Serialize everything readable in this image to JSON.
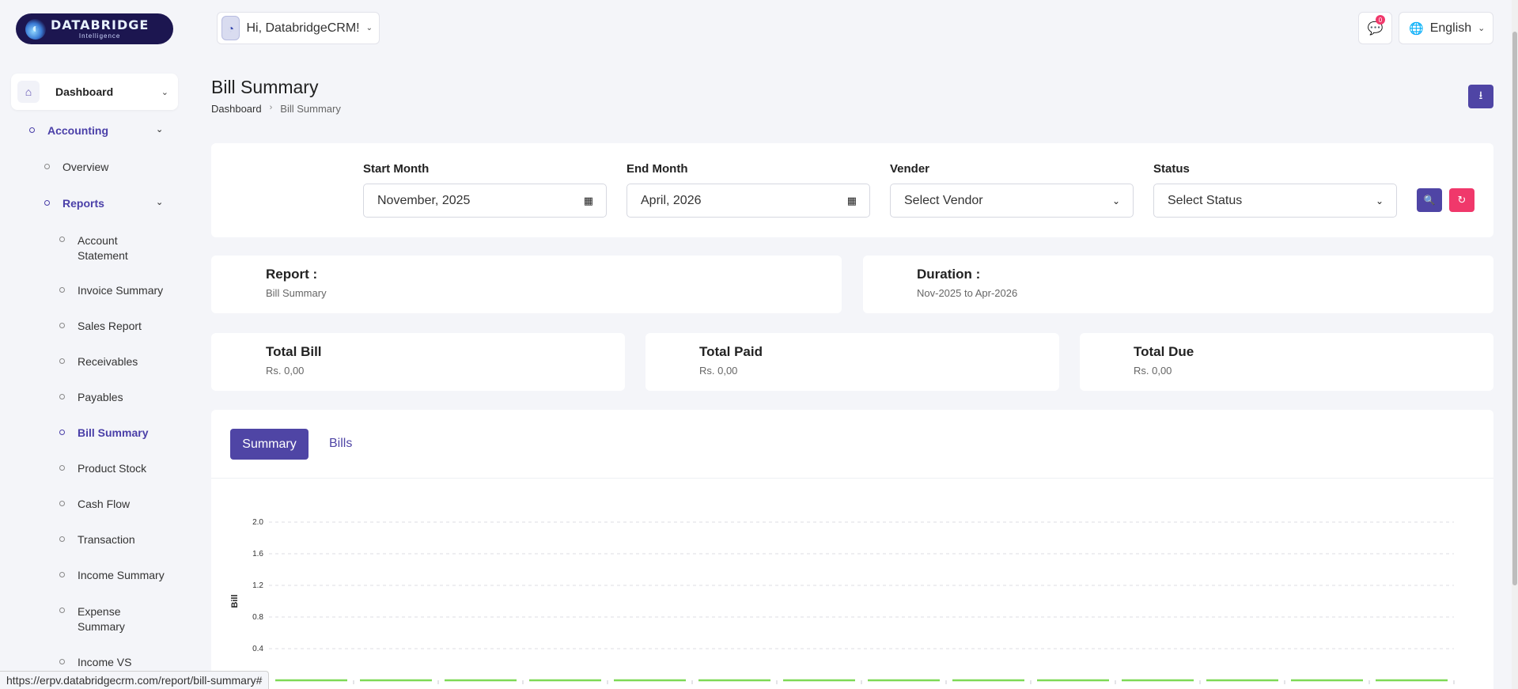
{
  "brand": {
    "name": "DATABRIDGE",
    "tagline": "Intelligence"
  },
  "sidebar": {
    "main": {
      "label": "Dashboard"
    },
    "accounting": {
      "label": "Accounting"
    },
    "overview": {
      "label": "Overview"
    },
    "reports": {
      "label": "Reports"
    },
    "report_items": [
      {
        "label": "Account Statement"
      },
      {
        "label": "Invoice Summary"
      },
      {
        "label": "Sales Report"
      },
      {
        "label": "Receivables"
      },
      {
        "label": "Payables"
      },
      {
        "label": "Bill Summary"
      },
      {
        "label": "Product Stock"
      },
      {
        "label": "Cash Flow"
      },
      {
        "label": "Transaction"
      },
      {
        "label": "Income Summary"
      },
      {
        "label": "Expense Summary"
      },
      {
        "label": "Income VS"
      }
    ],
    "active_item": "Bill Summary"
  },
  "topbar": {
    "greeting": "Hi, DatabridgeCRM!",
    "notification_count": "0",
    "language": "English"
  },
  "page": {
    "title": "Bill Summary",
    "breadcrumb": [
      "Dashboard",
      "Bill Summary"
    ]
  },
  "filters": {
    "start_month": {
      "label": "Start Month",
      "value": "November, 2025"
    },
    "end_month": {
      "label": "End Month",
      "value": "April, 2026"
    },
    "vendor": {
      "label": "Vender",
      "value": "Select Vendor"
    },
    "status": {
      "label": "Status",
      "value": "Select Status"
    }
  },
  "report_info": {
    "report": {
      "title": "Report :",
      "value": "Bill Summary"
    },
    "duration": {
      "title": "Duration :",
      "value": "Nov-2025 to Apr-2026"
    }
  },
  "totals": {
    "bill": {
      "title": "Total Bill",
      "value": "Rs. 0,00"
    },
    "paid": {
      "title": "Total Paid",
      "value": "Rs. 0,00"
    },
    "due": {
      "title": "Total Due",
      "value": "Rs. 0,00"
    }
  },
  "tabs": {
    "summary": "Summary",
    "bills": "Bills"
  },
  "chart_data": {
    "type": "line",
    "ylabel": "Bill",
    "yticks": [
      "0.4",
      "0.8",
      "1.2",
      "1.6",
      "2.0"
    ],
    "ylim": [
      0,
      2.0
    ],
    "series": [
      {
        "values": [
          0,
          0,
          0,
          0,
          0,
          0,
          0,
          0,
          0,
          0,
          0,
          0,
          0,
          0
        ],
        "color": "#7ed957"
      }
    ],
    "grid": true
  },
  "status_bar": {
    "url": "https://erpv.databridgecrm.com/report/bill-summary#"
  }
}
